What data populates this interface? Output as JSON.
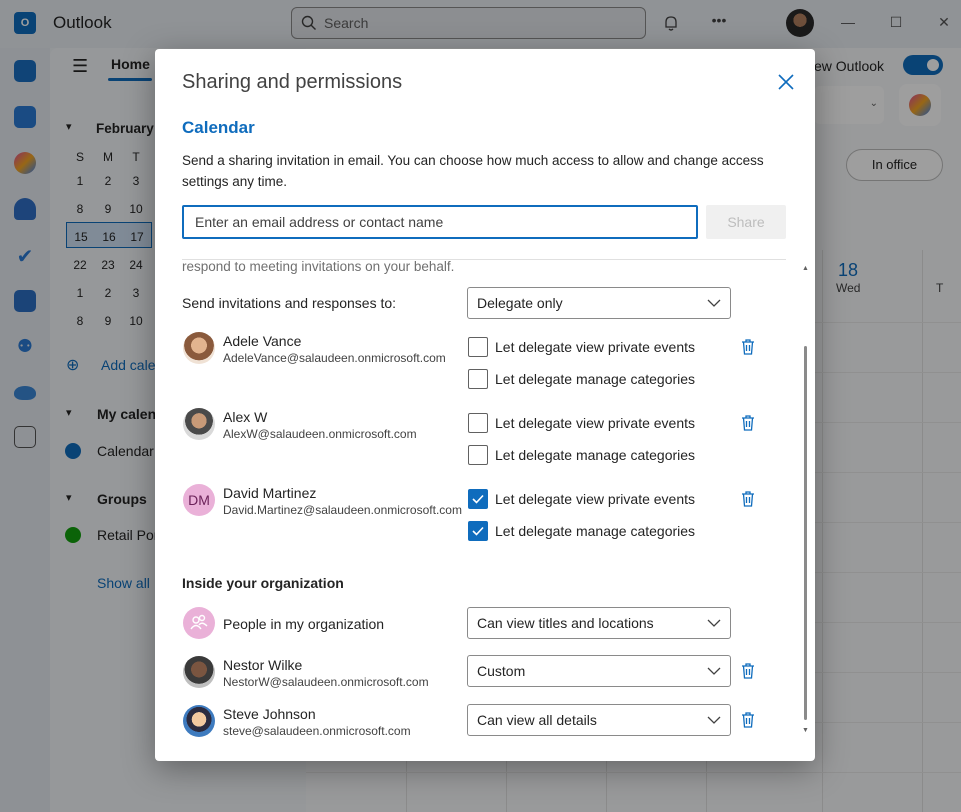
{
  "app": {
    "title": "Outlook",
    "search_placeholder": "Search",
    "new_outlook_label": "ew Outlook",
    "in_office_label": "In office"
  },
  "folder_pane": {
    "home_tab": "Home",
    "month": "February",
    "weekdays": [
      "S",
      "M",
      "T"
    ],
    "weeks": [
      [
        "1",
        "2",
        "3"
      ],
      [
        "8",
        "9",
        "10"
      ],
      [
        "15",
        "16",
        "17"
      ],
      [
        "22",
        "23",
        "24"
      ],
      [
        "1",
        "2",
        "3"
      ],
      [
        "8",
        "9",
        "10"
      ]
    ],
    "add_calendar": "Add cale",
    "my_calendars": "My calen",
    "calendar_item": "Calendar",
    "groups": "Groups",
    "group_item": "Retail Por",
    "show_all": "Show all"
  },
  "calendar_view": {
    "day_number": "18",
    "day_name": "Wed",
    "next_day_partial": "T"
  },
  "dialog": {
    "title": "Sharing and permissions",
    "subtitle": "Calendar",
    "description": "Send a sharing invitation in email. You can choose how much access to allow and change access settings any time.",
    "email_placeholder": "Enter an email address or contact name",
    "share_label": "Share",
    "cut_text": "respond to meeting invitations on your behalf.",
    "send_invitations_label": "Send invitations and responses to:",
    "send_invitations_value": "Delegate only",
    "view_private_label": "Let delegate view private events",
    "manage_categories_label": "Let delegate manage categories",
    "delegates": [
      {
        "name": "Adele Vance",
        "email": "AdeleVance@salaudeen.onmicrosoft.com",
        "view_private": false,
        "manage_categories": false
      },
      {
        "name": "Alex W",
        "email": "AlexW@salaudeen.onmicrosoft.com",
        "view_private": false,
        "manage_categories": false
      },
      {
        "name": "David Martinez",
        "email": "David.Martinez@salaudeen.onmicrosoft.com",
        "initials": "DM",
        "view_private": true,
        "manage_categories": true
      }
    ],
    "inside_org_title": "Inside your organization",
    "org_entries": [
      {
        "name": "People in my organization",
        "permission": "Can view titles and locations"
      },
      {
        "name": "Nestor Wilke",
        "email": "NestorW@salaudeen.onmicrosoft.com",
        "permission": "Custom"
      },
      {
        "name": "Steve Johnson",
        "email": "steve@salaudeen.onmicrosoft.com",
        "permission": "Can view all details"
      }
    ]
  },
  "colors": {
    "accent": "#0f6cbd",
    "dm_avatar_bg": "#eab1d8",
    "dm_avatar_text": "#6b2259"
  }
}
